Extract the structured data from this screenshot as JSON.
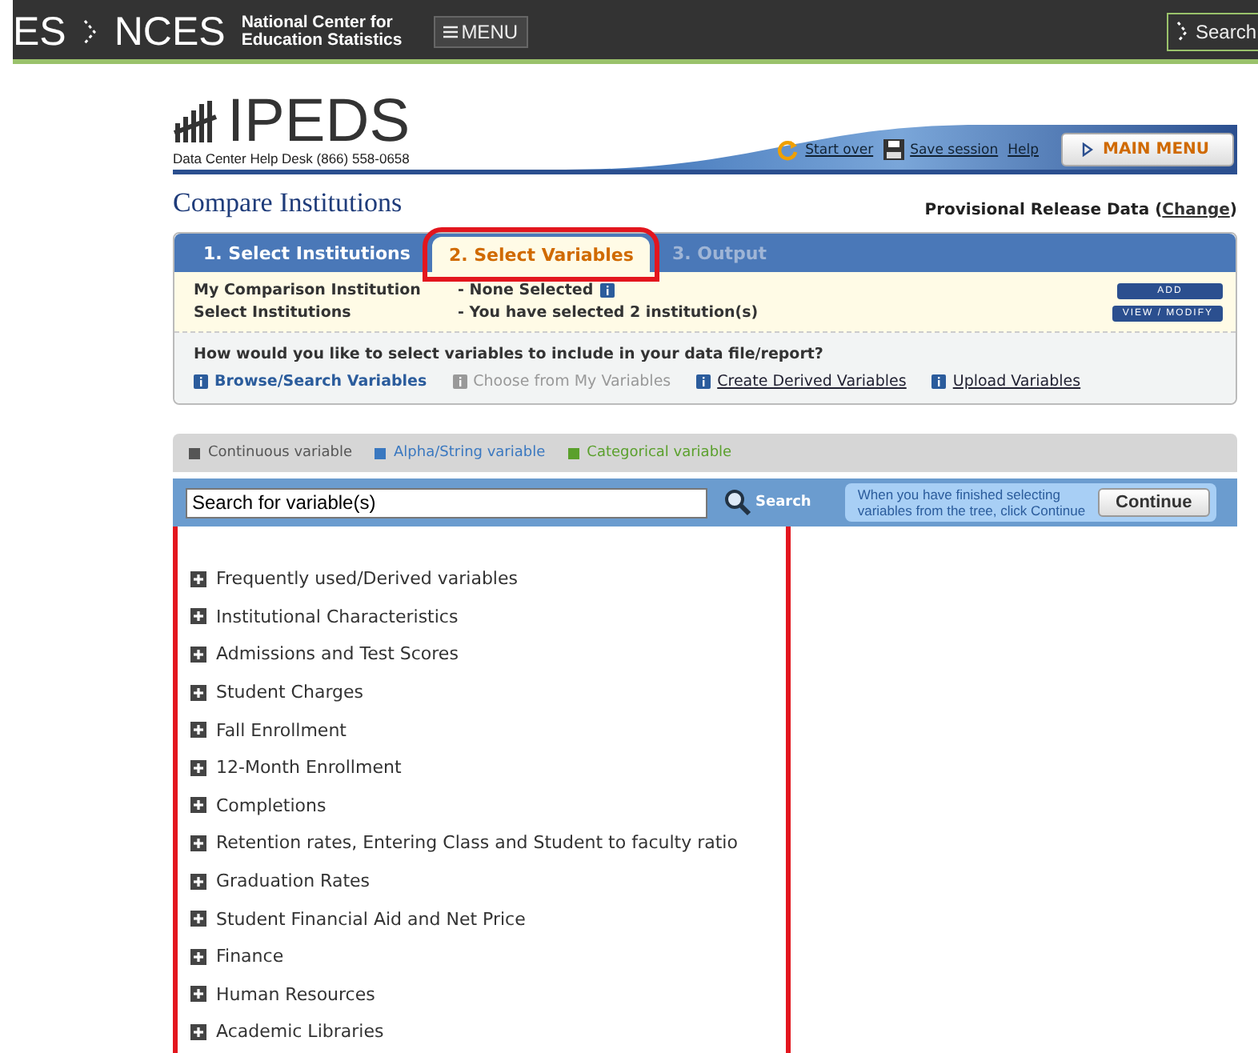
{
  "top_bar": {
    "brand_left": "ES",
    "brand_right": "NCES",
    "brand_subtitle": [
      "National Center for",
      "Education Statistics"
    ],
    "menu_button": "MENU",
    "search_button": "Search"
  },
  "header": {
    "logo": "IPEDS",
    "help_desk": "Data Center Help Desk (866) 558-0658",
    "links": [
      {
        "kind": "start",
        "label": "Start over"
      },
      {
        "kind": "save",
        "label": "Save session"
      },
      {
        "kind": "plain",
        "label": "Help"
      }
    ],
    "main_menu": "MAIN MENU"
  },
  "page_title": "Compare Institutions",
  "release": {
    "label": "Provisional Release Data",
    "open": "(",
    "link": "Change",
    "close": ")"
  },
  "tabs": [
    {
      "label": "1. Select Institutions",
      "selected": false,
      "disabled": false,
      "highlighted": false
    },
    {
      "label": "2. Select Variables",
      "selected": true,
      "disabled": false,
      "highlighted": true
    },
    {
      "label": "3. Output",
      "selected": false,
      "disabled": true,
      "highlighted": false
    }
  ],
  "selection": [
    {
      "label": "My Comparison Institution",
      "value": "- None Selected",
      "info": true,
      "button": "ADD"
    },
    {
      "label": "Select Institutions",
      "value": "- You have selected 2 institution(s)",
      "info": false,
      "button": "VIEW / MODIFY"
    }
  ],
  "question": "How would you like to select variables to include in your data file/report?",
  "methods": [
    {
      "label": "Browse/Search Variables",
      "selected": true,
      "disabled": false
    },
    {
      "label": "Choose from My Variables",
      "selected": false,
      "disabled": true
    },
    {
      "label": "Create Derived Variables",
      "selected": false,
      "disabled": false
    },
    {
      "label": "Upload Variables",
      "selected": false,
      "disabled": false
    }
  ],
  "legend": [
    {
      "label": "Continuous variable",
      "color": "#555555"
    },
    {
      "label": "Alpha/String variable",
      "color": "#3a78c0"
    },
    {
      "label": "Categorical variable",
      "color": "#5aa02c"
    }
  ],
  "search": {
    "value": "Search for variable(s)",
    "button": "Search",
    "hint": [
      "When you have finished selecting",
      "variables from the tree, click Continue"
    ],
    "continue": "Continue"
  },
  "tree": {
    "highlighted": true,
    "items": [
      {
        "label": "Frequently used/Derived variables",
        "expanded": false
      },
      {
        "label": "Institutional Characteristics",
        "expanded": false
      },
      {
        "label": "Admissions and Test Scores",
        "expanded": false
      },
      {
        "label": "Student Charges",
        "expanded": false
      },
      {
        "label": "Fall Enrollment",
        "expanded": false
      },
      {
        "label": "12-Month Enrollment",
        "expanded": false
      },
      {
        "label": "Completions",
        "expanded": false
      },
      {
        "label": "Retention rates, Entering Class and Student to faculty ratio",
        "expanded": false
      },
      {
        "label": "Graduation Rates",
        "expanded": false
      },
      {
        "label": "Student Financial Aid and Net Price",
        "expanded": false
      },
      {
        "label": "Finance",
        "expanded": false
      },
      {
        "label": "Human Resources",
        "expanded": false
      },
      {
        "label": "Academic Libraries",
        "expanded": false
      }
    ]
  }
}
